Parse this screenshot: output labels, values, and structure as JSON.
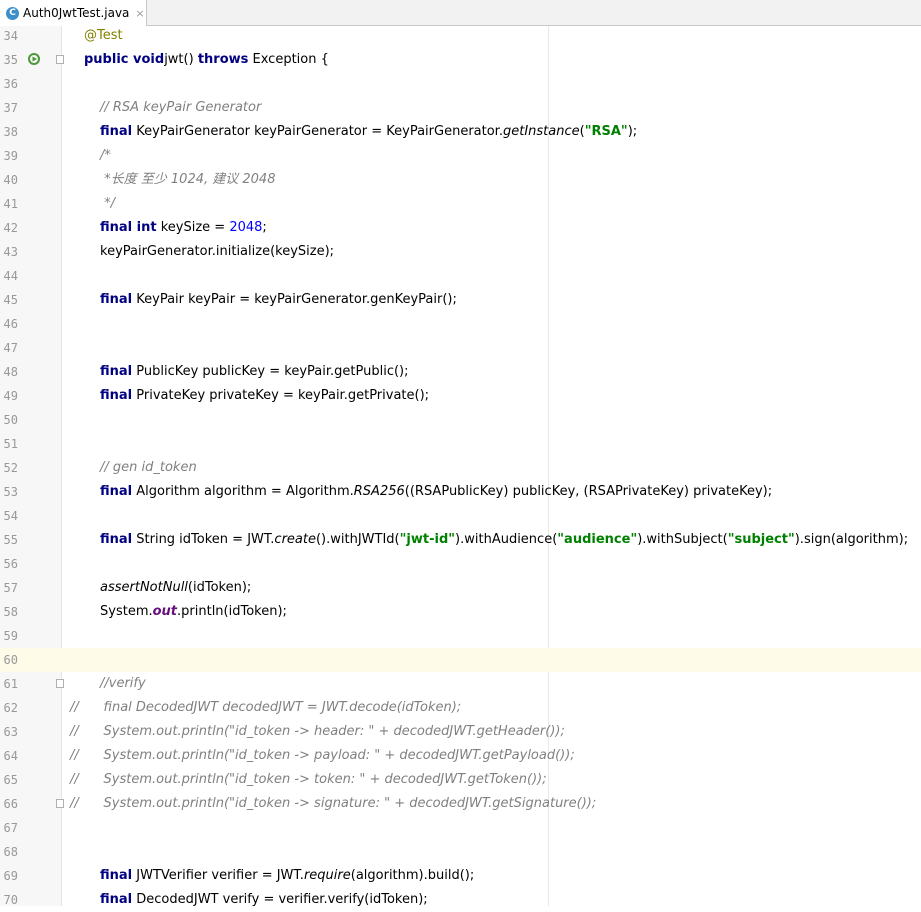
{
  "tab": {
    "title": "Auth0JwtTest.java",
    "icon": "C",
    "close": "×"
  },
  "colors": {
    "keyword": "#000080",
    "string": "#008000",
    "number": "#0000ff",
    "comment": "#808080",
    "annotation": "#808000",
    "static_field": "#660e7a",
    "current_line": "#fefbe8"
  },
  "lines": [
    {
      "n": "34",
      "indent": 1,
      "tokens": [
        [
          "anno",
          "@Test"
        ]
      ]
    },
    {
      "n": "35",
      "indent": 1,
      "run": true,
      "fold": true,
      "tokens": [
        [
          "kw",
          "public void"
        ],
        [
          "",
          "jwt() "
        ],
        [
          "kw",
          "throws"
        ],
        [
          "",
          " Exception {"
        ]
      ]
    },
    {
      "n": "36",
      "indent": 0,
      "tokens": []
    },
    {
      "n": "37",
      "indent": 2,
      "tokens": [
        [
          "cmt",
          "// RSA keyPair Generator"
        ]
      ]
    },
    {
      "n": "38",
      "indent": 2,
      "tokens": [
        [
          "kw",
          "final"
        ],
        [
          "",
          " KeyPairGenerator keyPairGenerator = KeyPairGenerator."
        ],
        [
          "it",
          "getInstance"
        ],
        [
          "",
          "("
        ],
        [
          "str",
          "\"RSA\""
        ],
        [
          "",
          ");"
        ]
      ]
    },
    {
      "n": "39",
      "indent": 2,
      "tokens": [
        [
          "cmt",
          "/*"
        ]
      ]
    },
    {
      "n": "40",
      "indent": 2,
      "tokens": [
        [
          "cmt",
          " *长度 至少 1024, 建议 2048"
        ]
      ]
    },
    {
      "n": "41",
      "indent": 2,
      "tokens": [
        [
          "cmt",
          " */"
        ]
      ]
    },
    {
      "n": "42",
      "indent": 2,
      "tokens": [
        [
          "kw",
          "final int"
        ],
        [
          "",
          " keySize = "
        ],
        [
          "num",
          "2048"
        ],
        [
          "",
          ";"
        ]
      ]
    },
    {
      "n": "43",
      "indent": 2,
      "tokens": [
        [
          "",
          "keyPairGenerator.initialize(keySize);"
        ]
      ]
    },
    {
      "n": "44",
      "indent": 0,
      "tokens": []
    },
    {
      "n": "45",
      "indent": 2,
      "tokens": [
        [
          "kw",
          "final"
        ],
        [
          "",
          " KeyPair keyPair = keyPairGenerator.genKeyPair();"
        ]
      ]
    },
    {
      "n": "46",
      "indent": 0,
      "tokens": []
    },
    {
      "n": "47",
      "indent": 0,
      "tokens": []
    },
    {
      "n": "48",
      "indent": 2,
      "tokens": [
        [
          "kw",
          "final"
        ],
        [
          "",
          " PublicKey publicKey = keyPair.getPublic();"
        ]
      ]
    },
    {
      "n": "49",
      "indent": 2,
      "tokens": [
        [
          "kw",
          "final"
        ],
        [
          "",
          " PrivateKey privateKey = keyPair.getPrivate();"
        ]
      ]
    },
    {
      "n": "50",
      "indent": 0,
      "tokens": []
    },
    {
      "n": "51",
      "indent": 0,
      "tokens": []
    },
    {
      "n": "52",
      "indent": 2,
      "tokens": [
        [
          "cmt",
          "// gen id_token"
        ]
      ]
    },
    {
      "n": "53",
      "indent": 2,
      "tokens": [
        [
          "kw",
          "final"
        ],
        [
          "",
          " Algorithm algorithm = Algorithm."
        ],
        [
          "it",
          "RSA256"
        ],
        [
          "",
          "((RSAPublicKey) publicKey, (RSAPrivateKey) privateKey);"
        ]
      ]
    },
    {
      "n": "54",
      "indent": 0,
      "tokens": []
    },
    {
      "n": "55",
      "indent": 2,
      "tokens": [
        [
          "kw",
          "final"
        ],
        [
          "",
          " String idToken = JWT."
        ],
        [
          "it",
          "create"
        ],
        [
          "",
          "().withJWTId("
        ],
        [
          "str",
          "\"jwt-id\""
        ],
        [
          "",
          ").withAudience("
        ],
        [
          "str",
          "\"audience\""
        ],
        [
          "",
          ").withSubject("
        ],
        [
          "str",
          "\"subject\""
        ],
        [
          "",
          ").sign(algorithm);"
        ]
      ]
    },
    {
      "n": "56",
      "indent": 0,
      "tokens": []
    },
    {
      "n": "57",
      "indent": 2,
      "tokens": [
        [
          "it",
          "assertNotNull"
        ],
        [
          "",
          "(idToken);"
        ]
      ]
    },
    {
      "n": "58",
      "indent": 2,
      "tokens": [
        [
          "",
          "System."
        ],
        [
          "fld",
          "out"
        ],
        [
          "",
          ".println(idToken);"
        ]
      ]
    },
    {
      "n": "59",
      "indent": 0,
      "tokens": []
    },
    {
      "n": "60",
      "indent": 0,
      "current": true,
      "tokens": []
    },
    {
      "n": "61",
      "indent": 2,
      "fold": true,
      "tokens": [
        [
          "cmt",
          "//verify"
        ]
      ]
    },
    {
      "n": "62",
      "indent": 0,
      "tokens": [
        [
          "cmt",
          "//      final DecodedJWT decodedJWT = JWT.decode(idToken);"
        ]
      ]
    },
    {
      "n": "63",
      "indent": 0,
      "tokens": [
        [
          "cmt",
          "//      System.out.println(\"id_token -> header: \" + decodedJWT.getHeader());"
        ]
      ]
    },
    {
      "n": "64",
      "indent": 0,
      "tokens": [
        [
          "cmt",
          "//      System.out.println(\"id_token -> payload: \" + decodedJWT.getPayload());"
        ]
      ]
    },
    {
      "n": "65",
      "indent": 0,
      "tokens": [
        [
          "cmt",
          "//      System.out.println(\"id_token -> token: \" + decodedJWT.getToken());"
        ]
      ]
    },
    {
      "n": "66",
      "indent": 0,
      "fold": true,
      "tokens": [
        [
          "cmt",
          "//      System.out.println(\"id_token -> signature: \" + decodedJWT.getSignature());"
        ]
      ]
    },
    {
      "n": "67",
      "indent": 0,
      "tokens": []
    },
    {
      "n": "68",
      "indent": 0,
      "tokens": []
    },
    {
      "n": "69",
      "indent": 2,
      "tokens": [
        [
          "kw",
          "final"
        ],
        [
          "",
          " JWTVerifier verifier = JWT."
        ],
        [
          "it",
          "require"
        ],
        [
          "",
          "(algorithm).build();"
        ]
      ]
    },
    {
      "n": "70",
      "indent": 2,
      "tokens": [
        [
          "kw",
          "final"
        ],
        [
          "",
          " DecodedJWT verify = verifier.verify(idToken);"
        ]
      ]
    }
  ]
}
